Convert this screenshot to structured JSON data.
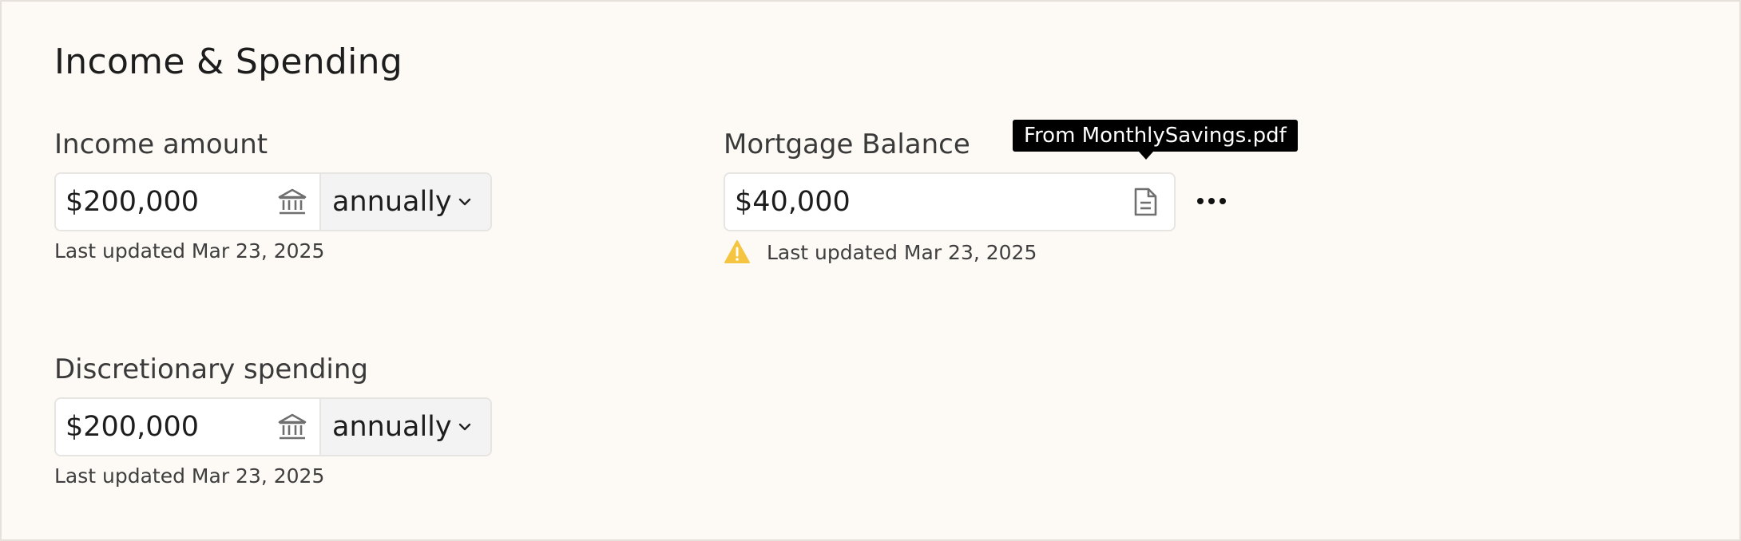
{
  "section": {
    "title": "Income & Spending"
  },
  "income": {
    "label": "Income amount",
    "value": "$200,000",
    "icon": "bank-icon",
    "frequency": "annually",
    "last_updated": "Last updated Mar 23, 2025"
  },
  "mortgage": {
    "label": "Mortgage Balance",
    "value": "$40,000",
    "icon": "document-icon",
    "tooltip": "From MonthlySavings.pdf",
    "last_updated": "Last updated Mar 23, 2025",
    "status_icon": "warning-icon",
    "more_icon": "more-horizontal-icon"
  },
  "discretionary": {
    "label": "Discretionary spending",
    "value": "$200,000",
    "icon": "bank-icon",
    "frequency": "annually",
    "last_updated": "Last updated Mar 23, 2025"
  },
  "colors": {
    "background": "#fdf9f5",
    "warning": "#f5c542",
    "tooltip_bg": "#000000"
  }
}
